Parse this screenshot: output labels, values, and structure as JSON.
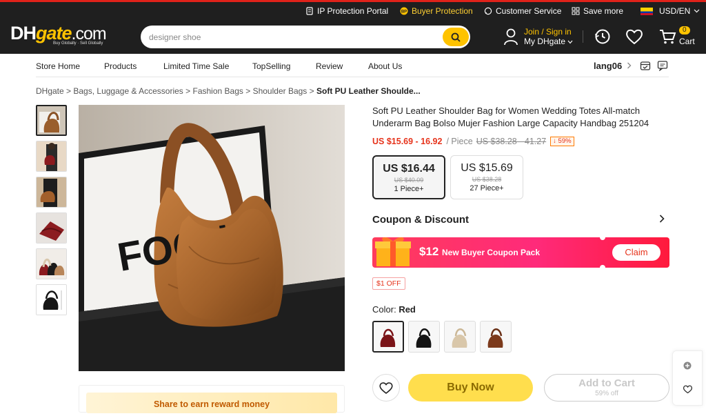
{
  "topbar": {
    "ip_protection": "IP Protection Portal",
    "buyer_protection": "Buyer Protection",
    "customer_service": "Customer Service",
    "save_more": "Save more",
    "currency": "USD/EN"
  },
  "header": {
    "logo_dh": "DH",
    "logo_gate": "gate",
    "logo_com": ".com",
    "logo_tagline": "Buy Globally · Sell Globally",
    "search_placeholder": "designer shoe",
    "join_signin": "Join / Sign in",
    "my_dhgate": "My DHgate",
    "cart_count": "0",
    "cart_label": "Cart"
  },
  "store_nav": {
    "items": [
      "Store Home",
      "Products",
      "Limited Time Sale",
      "TopSelling",
      "Review",
      "About Us"
    ],
    "store_name": "lang06"
  },
  "breadcrumb": {
    "items": [
      "DHgate",
      "Bags, Luggage & Accessories",
      "Fashion Bags",
      "Shoulder Bags"
    ],
    "current": "Soft PU Leather Shoulde..."
  },
  "product": {
    "title": "Soft PU Leather Shoulder Bag for Women Wedding Totes All-match Underarm Bag Bolso Mujer Fashion Large Capacity Handbag 251204",
    "price_range": "US $15.69 - 16.92",
    "unit": "/ Piece",
    "old_price_range": "US $38.28 - 41.27",
    "discount": "↓ 59%",
    "tiers": [
      {
        "price": "US $16.44",
        "old": "US $40.09",
        "qty": "1 Piece+"
      },
      {
        "price": "US $15.69",
        "old": "US $38.28",
        "qty": "27 Piece+"
      }
    ],
    "image_text": "FOCUS"
  },
  "coupon": {
    "heading": "Coupon & Discount",
    "amount": "$12",
    "pack_text": "New Buyer Coupon Pack",
    "claim": "Claim",
    "off_badge": "$1 OFF"
  },
  "color": {
    "label": "Color:",
    "selected": "Red",
    "swatches": [
      "Red",
      "Black",
      "Beige",
      "Brown"
    ]
  },
  "actions": {
    "buy_now": "Buy Now",
    "add_to_cart": "Add to Cart",
    "add_to_cart_sub": "59% off",
    "share": "Share to earn reward money"
  },
  "colors": {
    "brand_yellow": "#ffc300",
    "price_red": "#e6331b",
    "header_bg": "#1f1f1f"
  }
}
